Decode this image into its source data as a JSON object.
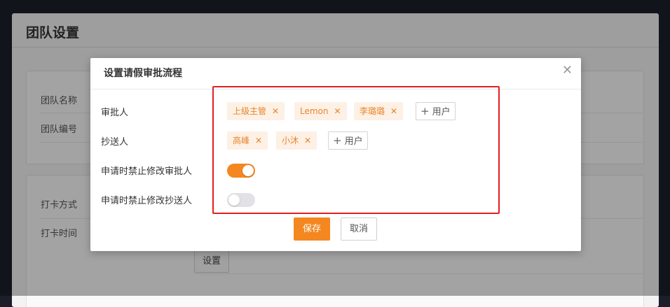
{
  "page": {
    "title": "团队设置",
    "labels": {
      "team_name": "团队名称",
      "team_id": "团队编号",
      "clock_method": "打卡方式",
      "clock_time": "打卡时间"
    },
    "set_button": "设置"
  },
  "modal": {
    "title": "设置请假审批流程",
    "close_icon": "close-icon",
    "approver_label": "审批人",
    "approvers": [
      "上级主管",
      "Lemon",
      "李璐璐"
    ],
    "cc_label": "抄送人",
    "cc_list": [
      "高峰",
      "小沐"
    ],
    "add_user_label": "用户",
    "forbid_edit_approver_label": "申请时禁止修改审批人",
    "forbid_edit_approver_on": true,
    "forbid_edit_cc_label": "申请时禁止修改抄送人",
    "forbid_edit_cc_on": false,
    "save_label": "保存",
    "cancel_label": "取消"
  },
  "colors": {
    "accent": "#f4871f",
    "tag_bg": "#fdf0e4",
    "highlight": "#e02020"
  }
}
